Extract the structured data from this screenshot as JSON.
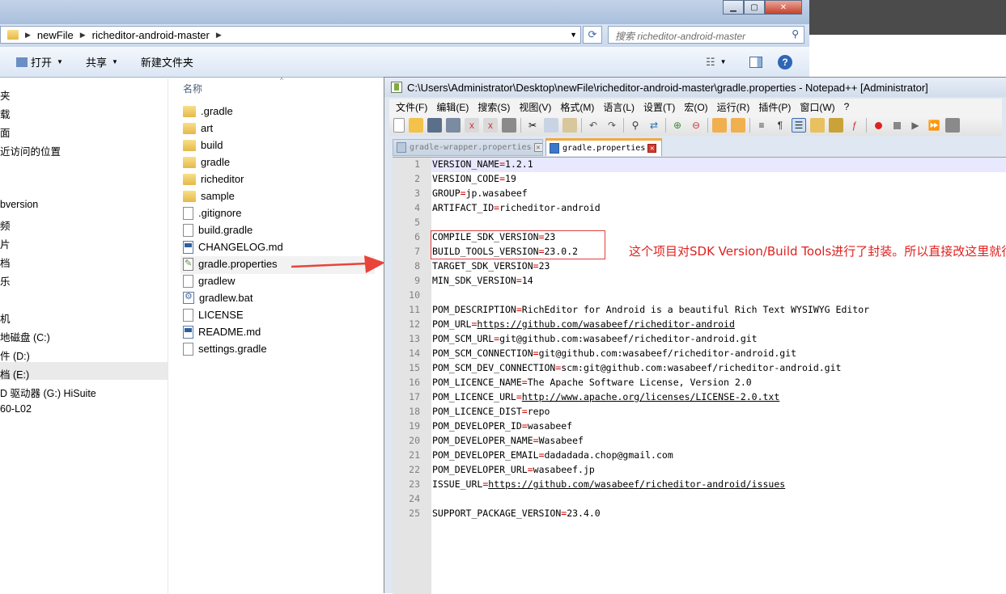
{
  "explorer": {
    "address": {
      "segments": [
        "newFile",
        "richeditor-android-master"
      ]
    },
    "search": {
      "placeholder": "搜索 richeditor-android-master"
    },
    "commands": {
      "open": "打开",
      "share": "共享",
      "new_folder": "新建文件夹"
    },
    "nav_items": [
      "夹",
      "载",
      "面",
      "近访问的位置",
      "bversion",
      "频",
      "片",
      "档",
      "乐",
      "机",
      "地磁盘 (C:)",
      "件 (D:)",
      "档 (E:)",
      "D 驱动器 (G:) HiSuite",
      "60-L02"
    ],
    "column_name": "名称",
    "files": [
      {
        "name": ".gradle",
        "type": "folder"
      },
      {
        "name": "art",
        "type": "folder"
      },
      {
        "name": "build",
        "type": "folder"
      },
      {
        "name": "gradle",
        "type": "folder"
      },
      {
        "name": "richeditor",
        "type": "folder"
      },
      {
        "name": "sample",
        "type": "folder"
      },
      {
        "name": ".gitignore",
        "type": "doc"
      },
      {
        "name": "build.gradle",
        "type": "doc"
      },
      {
        "name": "CHANGELOG.md",
        "type": "md"
      },
      {
        "name": "gradle.properties",
        "type": "props"
      },
      {
        "name": "gradlew",
        "type": "doc"
      },
      {
        "name": "gradlew.bat",
        "type": "bat"
      },
      {
        "name": "LICENSE",
        "type": "doc"
      },
      {
        "name": "README.md",
        "type": "md"
      },
      {
        "name": "settings.gradle",
        "type": "doc"
      }
    ]
  },
  "notepad": {
    "title": "C:\\Users\\Administrator\\Desktop\\newFile\\richeditor-android-master\\gradle.properties - Notepad++ [Administrator]",
    "menu": [
      "文件(F)",
      "编辑(E)",
      "搜索(S)",
      "视图(V)",
      "格式(M)",
      "语言(L)",
      "设置(T)",
      "宏(O)",
      "运行(R)",
      "插件(P)",
      "窗口(W)",
      "?"
    ],
    "tabs": [
      {
        "label": "gradle-wrapper.properties",
        "active": false
      },
      {
        "label": "gradle.properties",
        "active": true
      }
    ],
    "lines": [
      {
        "n": "1",
        "key": "VERSION_NAME",
        "val": "1.2.1"
      },
      {
        "n": "2",
        "key": "VERSION_CODE",
        "val": "19"
      },
      {
        "n": "3",
        "key": "GROUP",
        "val": "jp.wasabeef"
      },
      {
        "n": "4",
        "key": "ARTIFACT_ID",
        "val": "richeditor-android"
      },
      {
        "n": "5",
        "key": "",
        "val": ""
      },
      {
        "n": "6",
        "key": "COMPILE_SDK_VERSION",
        "val": "23"
      },
      {
        "n": "7",
        "key": "BUILD_TOOLS_VERSION",
        "val": "23.0.2"
      },
      {
        "n": "8",
        "key": "TARGET_SDK_VERSION",
        "val": "23"
      },
      {
        "n": "9",
        "key": "MIN_SDK_VERSION",
        "val": "14"
      },
      {
        "n": "10",
        "key": "",
        "val": ""
      },
      {
        "n": "11",
        "key": "POM_DESCRIPTION",
        "val": "RichEditor for Android is a beautiful Rich Text WYSIWYG Editor"
      },
      {
        "n": "12",
        "key": "POM_URL",
        "val": "https://github.com/wasabeef/richeditor-android",
        "url": true
      },
      {
        "n": "13",
        "key": "POM_SCM_URL",
        "val": "git@github.com:wasabeef/richeditor-android.git"
      },
      {
        "n": "14",
        "key": "POM_SCM_CONNECTION",
        "val": "git@github.com:wasabeef/richeditor-android.git"
      },
      {
        "n": "15",
        "key": "POM_SCM_DEV_CONNECTION",
        "val": "scm:git@github.com:wasabeef/richeditor-android.git"
      },
      {
        "n": "16",
        "key": "POM_LICENCE_NAME",
        "val": "The Apache Software License, Version 2.0"
      },
      {
        "n": "17",
        "key": "POM_LICENCE_URL",
        "val": "http://www.apache.org/licenses/LICENSE-2.0.txt",
        "url": true
      },
      {
        "n": "18",
        "key": "POM_LICENCE_DIST",
        "val": "repo"
      },
      {
        "n": "19",
        "key": "POM_DEVELOPER_ID",
        "val": "wasabeef"
      },
      {
        "n": "20",
        "key": "POM_DEVELOPER_NAME",
        "val": "Wasabeef"
      },
      {
        "n": "21",
        "key": "POM_DEVELOPER_EMAIL",
        "val": "dadadada.chop@gmail.com"
      },
      {
        "n": "22",
        "key": "POM_DEVELOPER_URL",
        "val": "wasabeef.jp"
      },
      {
        "n": "23",
        "key": "ISSUE_URL",
        "val": "https://github.com/wasabeef/richeditor-android/issues",
        "url": true
      },
      {
        "n": "24",
        "key": "",
        "val": ""
      },
      {
        "n": "25",
        "key": "SUPPORT_PACKAGE_VERSION",
        "val": "23.4.0"
      }
    ],
    "annotation": "这个项目对SDK Version/Build Tools进行了封装。所以直接改这里就行"
  },
  "colors": {
    "accent_red": "#e02020",
    "tab_active_top": "#f5a83d",
    "current_line": "#e8e8ff"
  }
}
